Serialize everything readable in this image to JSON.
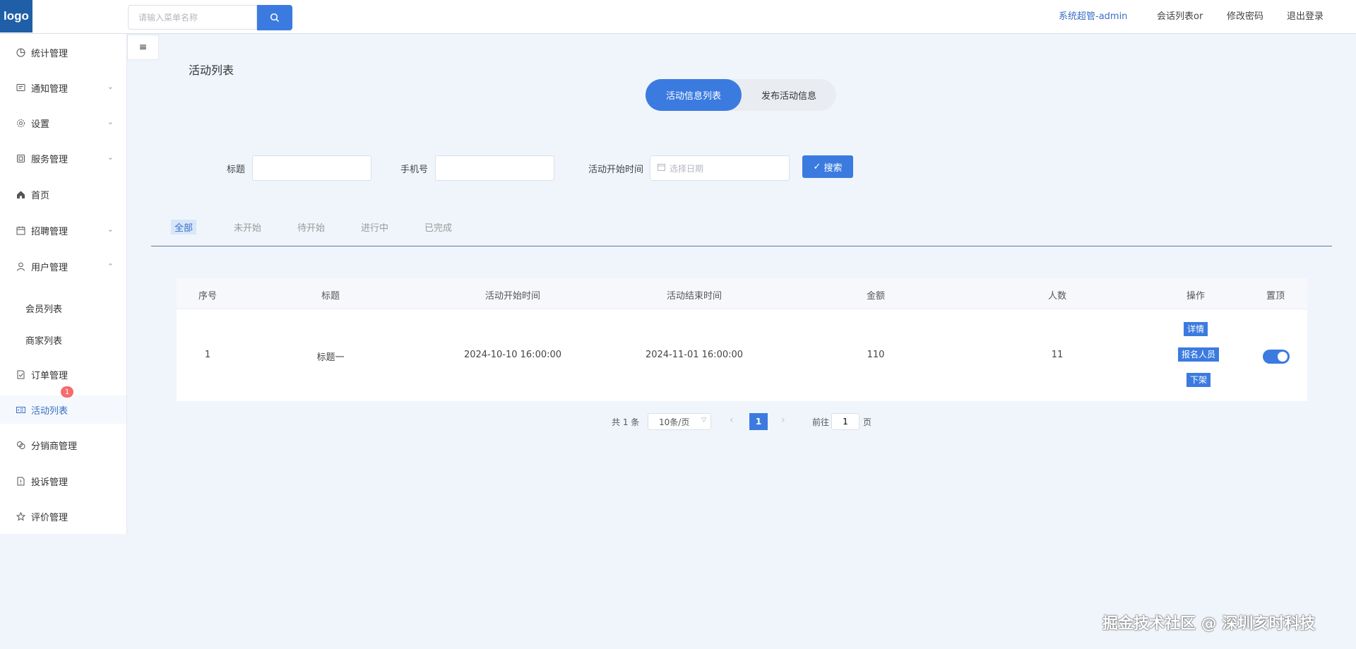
{
  "header": {
    "logo": "logo",
    "search_placeholder": "请输入菜单名称",
    "admin": "系统超管-admin",
    "chat_list": "会话列表or",
    "change_password": "修改密码",
    "logout": "退出登录"
  },
  "sidebar": {
    "items": [
      {
        "label": "统计管理",
        "icon": "pie-chart-icon"
      },
      {
        "label": "通知管理",
        "icon": "message-icon"
      },
      {
        "label": "设置",
        "icon": "gear-icon"
      },
      {
        "label": "服务管理",
        "icon": "service-icon"
      },
      {
        "label": "首页",
        "icon": "home-icon"
      },
      {
        "label": "招聘管理",
        "icon": "calendar-icon"
      },
      {
        "label": "用户管理",
        "icon": "user-icon"
      },
      {
        "label": "会员列表"
      },
      {
        "label": "商家列表"
      },
      {
        "label": "订单管理",
        "icon": "order-icon"
      },
      {
        "label": "活动列表",
        "icon": "activity-icon"
      },
      {
        "label": "分销商管理",
        "icon": "distributor-icon"
      },
      {
        "label": "投诉管理",
        "icon": "complaint-icon"
      },
      {
        "label": "评价管理",
        "icon": "star-icon"
      }
    ],
    "badge": "1"
  },
  "page": {
    "title": "活动列表",
    "seg_active": "活动信息列表",
    "seg_inactive": "发布活动信息"
  },
  "filters": {
    "title_label": "标题",
    "phone_label": "手机号",
    "start_label": "活动开始时间",
    "date_placeholder": "选择日期",
    "search_button": "搜索"
  },
  "tabs": [
    "全部",
    "未开始",
    "待开始",
    "进行中",
    "已完成"
  ],
  "table": {
    "headers": [
      "序号",
      "标题",
      "活动开始时间",
      "活动结束时间",
      "金额",
      "人数",
      "操作",
      "置顶"
    ],
    "rows": [
      {
        "index": "1",
        "title": "标题一",
        "start": "2024-10-10 16:00:00",
        "end": "2024-11-01 16:00:00",
        "amount": "110",
        "people": "11",
        "actions": [
          "详情",
          "报名人员",
          "下架"
        ],
        "pinned": true
      }
    ]
  },
  "pagination": {
    "total": "共 1 条",
    "page_size": "10条/页",
    "current": "1",
    "goto": "前往",
    "goto_value": "1",
    "page_unit": "页"
  },
  "watermark": "掘金技术社区 @ 深圳亥时科技",
  "colors": {
    "accent": "#3b7be0",
    "badge": "#f56c6c",
    "logo_bg": "#1f5fa8"
  }
}
